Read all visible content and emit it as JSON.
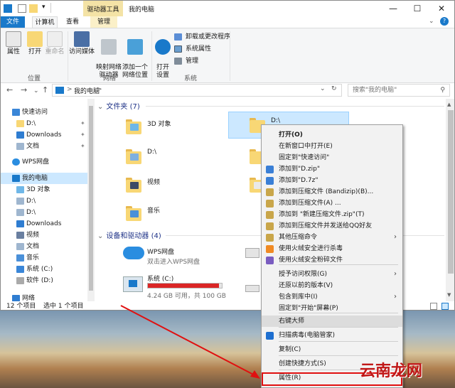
{
  "titlebar": {
    "context_tab": "驱动器工具",
    "title": "我的电脑",
    "minimize": "—",
    "maximize": "☐",
    "close": "✕"
  },
  "tabs": [
    "文件",
    "计算机",
    "查看",
    "管理"
  ],
  "ribbon": {
    "location": {
      "props": "属性",
      "open": "打开",
      "rename": "重命名",
      "group": "位置"
    },
    "network": {
      "media": "访问媒体",
      "map": "映射网络\n驱动器",
      "add": "添加一个\n网络位置",
      "group": "网络"
    },
    "system": {
      "open_settings": "打开\n设置",
      "uninstall": "卸载或更改程序",
      "sysprops": "系统属性",
      "manage": "管理",
      "group": "系统"
    }
  },
  "address": {
    "back": "←",
    "forward": "→",
    "dropdown": "⌄",
    "up": "↑",
    "path": "我的电脑",
    "path_sep": ">",
    "drop": "⌄",
    "refresh": "↻",
    "search_placeholder": "搜索\"我的电脑\""
  },
  "sidebar": {
    "quick": "快速访问",
    "items_quick": [
      "D:\\",
      "Downloads",
      "文档"
    ],
    "wps": "WPS网盘",
    "pc": "我的电脑",
    "pc_items": [
      "3D 对象",
      "D:\\",
      "D:\\",
      "Downloads",
      "视频",
      "文档",
      "音乐",
      "系统 (C:)",
      "软件 (D:)"
    ],
    "network": "网络"
  },
  "main": {
    "folders_header": "文件夹 (7)",
    "folders": [
      "3D 对象",
      "D:\\",
      "D:\\",
      "视频",
      "音乐"
    ],
    "drives_header": "设备和驱动器 (4)",
    "wps": {
      "name": "WPS网盘",
      "desc": "双击进入WPS网盘"
    },
    "sysdrive": {
      "name": "系统 (C:)",
      "free": "4.24 GB 可用，共 100 GB",
      "used_fraction": 0.96
    }
  },
  "status": {
    "count": "12 个项目",
    "selected": "选中 1 个项目"
  },
  "menu": {
    "items": [
      "打开(O)",
      "在新窗口中打开(E)",
      "固定到\"快速访问\"",
      "添加到\"D.zip\"",
      "添加到\"D.7z\"",
      "添加到压缩文件 (Bandizip)(B)...",
      "添加到压缩文件(A) ...",
      "添加到 \"新建压缩文件.zip\"(T)",
      "添加到压缩文件并发送给QQ好友",
      "其他压缩命令",
      "使用火绒安全进行杀毒",
      "使用火绒安全粉碎文件",
      "授予访问权限(G)",
      "还原以前的版本(V)",
      "包含到库中(I)",
      "固定到\"开始\"屏幕(P)",
      "右键大师",
      "扫描病毒(电脑管家)",
      "复制(C)",
      "创建快捷方式(S)",
      "属性(R)"
    ],
    "submenu_arrow": "›"
  },
  "watermark": "云南龙网",
  "colors": {
    "accent": "#1979ca",
    "highlight": "#cce8ff",
    "drive_bar": "#da2626",
    "annotation": "#e01010"
  }
}
